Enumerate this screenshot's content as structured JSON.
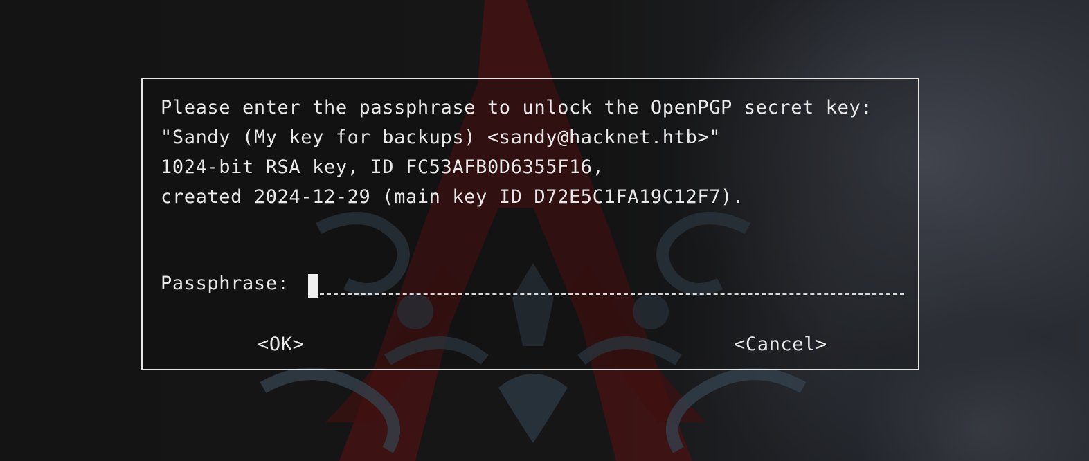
{
  "dialog": {
    "lines": [
      "Please enter the passphrase to unlock the OpenPGP secret key:",
      "\"Sandy (My key for backups) <sandy@hacknet.htb>\"",
      "1024-bit RSA key, ID FC53AFB0D6355F16,",
      "created 2024-12-29 (main key ID D72E5C1FA19C12F7)."
    ],
    "passphrase_label": "Passphrase:",
    "passphrase_value": "",
    "ok_label": "<OK>",
    "cancel_label": "<Cancel>"
  },
  "colors": {
    "text": "#e9e9e9",
    "border": "#e6e6e6",
    "background": "#151515",
    "emblem_red": "#5a1414",
    "emblem_slate": "#3b4c5a"
  }
}
